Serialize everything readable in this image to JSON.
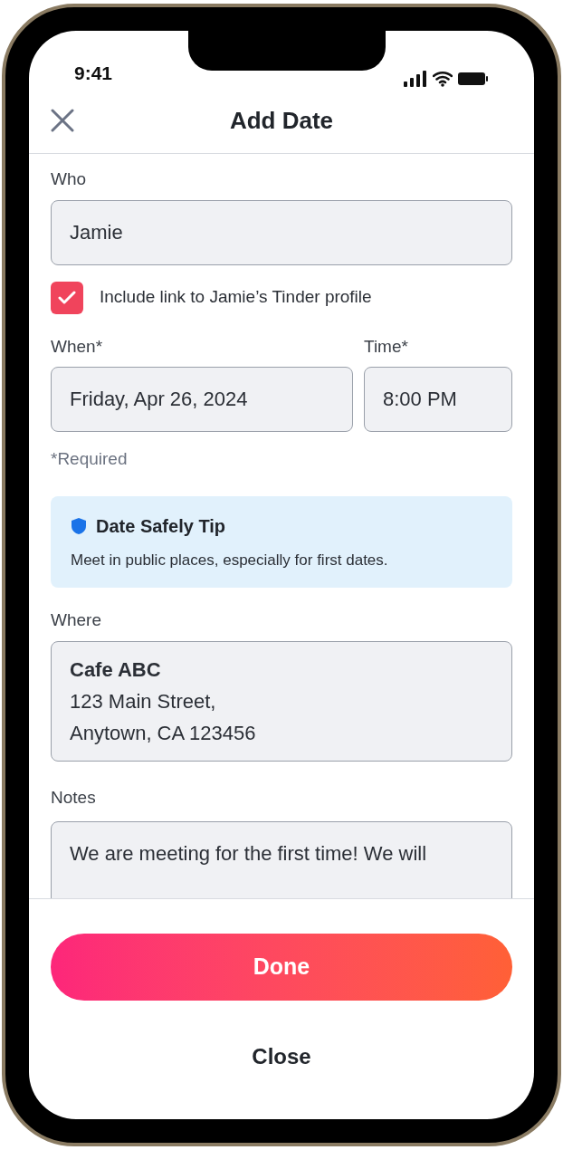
{
  "status_bar": {
    "time": "9:41"
  },
  "header": {
    "title": "Add Date"
  },
  "who": {
    "label": "Who",
    "value": "Jamie"
  },
  "include_link": {
    "label": "Include link to Jamie’s Tinder profile",
    "checked": true
  },
  "when": {
    "label": "When*",
    "value": "Friday, Apr 26, 2024"
  },
  "time": {
    "label": "Time*",
    "value": "8:00 PM"
  },
  "required_note": "*Required",
  "tip": {
    "title": "Date Safely Tip",
    "text": "Meet in public places, especially for first dates."
  },
  "where": {
    "label": "Where",
    "name": "Cafe ABC",
    "lines": [
      "123 Main Street,",
      "Anytown, CA 123456"
    ]
  },
  "notes": {
    "label": "Notes",
    "value": "We are meeting for the first time! We will"
  },
  "buttons": {
    "done": "Done",
    "close": "Close"
  }
}
